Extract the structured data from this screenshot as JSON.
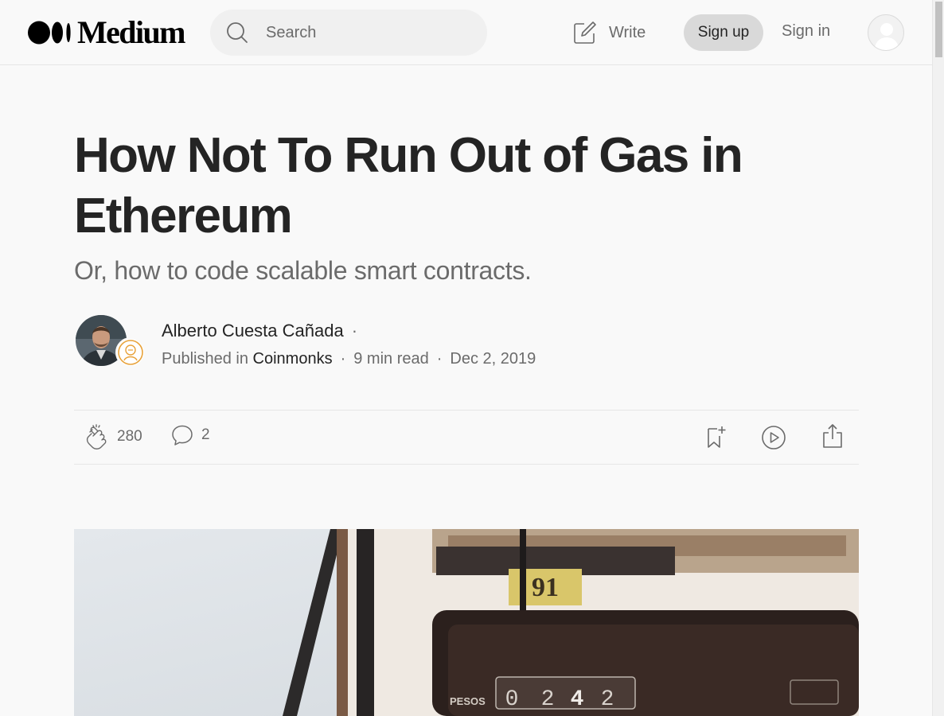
{
  "header": {
    "logo_text": "Medium",
    "search_placeholder": "Search",
    "write_label": "Write",
    "signup_label": "Sign up",
    "signin_label": "Sign in"
  },
  "article": {
    "title": "How Not To Run Out of Gas in Ethereum",
    "subtitle": "Or, how to code scalable smart contracts.",
    "author": "Alberto Cuesta Cañada",
    "author_separator": "·",
    "published_in_label": "Published in",
    "publication": "Coinmonks",
    "read_time": "9 min read",
    "date": "Dec 2, 2019",
    "meta_separator": "·"
  },
  "actions": {
    "claps": "280",
    "responses": "2"
  },
  "hero": {
    "fuel_label": "91",
    "currency_label": "PESOS",
    "counter_digits": [
      "0",
      "2",
      "4",
      "2"
    ]
  },
  "colors": {
    "text_primary": "#242424",
    "text_secondary": "#6b6b6b",
    "background": "#f9f9f9",
    "signup_button": "#d9d9d9",
    "publication_accent": "#e8a23a"
  }
}
